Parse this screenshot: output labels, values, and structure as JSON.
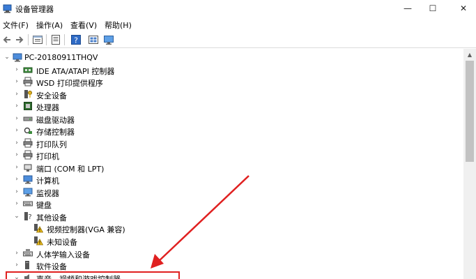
{
  "window": {
    "title": "设备管理器",
    "minimize_glyph": "—",
    "maximize_glyph": "☐",
    "close_glyph": "✕"
  },
  "menu": {
    "items": [
      "文件(F)",
      "操作(A)",
      "查看(V)",
      "帮助(H)"
    ]
  },
  "toolbar": {
    "buttons": [
      "back-icon",
      "forward-icon",
      "properties-icon",
      "show-hide-icon",
      "help-icon",
      "monitor-icon"
    ]
  },
  "tree": {
    "root": {
      "label": "PC-20180911THQV",
      "expanded": true,
      "icon": "computer-icon"
    },
    "items": [
      {
        "label": "IDE ATA/ATAPI 控制器",
        "icon": "ide-controller-icon",
        "expanded": false
      },
      {
        "label": "WSD 打印提供程序",
        "icon": "printer-icon",
        "expanded": false
      },
      {
        "label": "安全设备",
        "icon": "security-device-icon",
        "expanded": false
      },
      {
        "label": "处理器",
        "icon": "processor-icon",
        "expanded": false
      },
      {
        "label": "磁盘驱动器",
        "icon": "disk-drive-icon",
        "expanded": false
      },
      {
        "label": "存储控制器",
        "icon": "storage-controller-icon",
        "expanded": false
      },
      {
        "label": "打印队列",
        "icon": "print-queue-icon",
        "expanded": false
      },
      {
        "label": "打印机",
        "icon": "printer-icon",
        "expanded": false
      },
      {
        "label": "端口 (COM 和 LPT)",
        "icon": "port-icon",
        "expanded": false
      },
      {
        "label": "计算机",
        "icon": "computer-icon",
        "expanded": false
      },
      {
        "label": "监视器",
        "icon": "monitor-icon",
        "expanded": false
      },
      {
        "label": "键盘",
        "icon": "keyboard-icon",
        "expanded": false
      },
      {
        "label": "其他设备",
        "icon": "other-devices-icon",
        "expanded": true,
        "children": [
          {
            "label": "视频控制器(VGA 兼容)",
            "icon": "warning-device-icon"
          },
          {
            "label": "未知设备",
            "icon": "warning-device-icon"
          }
        ]
      },
      {
        "label": "人体学输入设备",
        "icon": "hid-icon",
        "expanded": false
      },
      {
        "label": "软件设备",
        "icon": "software-device-icon",
        "expanded": false
      },
      {
        "label": "声音、视频和游戏控制器",
        "icon": "sound-icon",
        "expanded": true
      }
    ]
  },
  "annotation": {
    "color": "#e02020"
  }
}
